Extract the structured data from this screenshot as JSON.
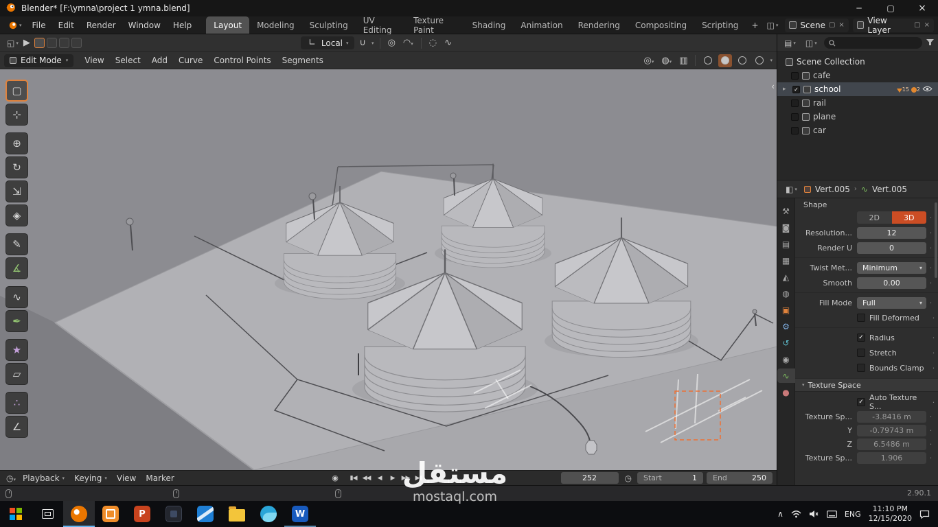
{
  "window": {
    "title": "Blender* [F:\\ymna\\project 1 ymna.blend]",
    "minimize": "─",
    "maximize": "▢",
    "close": "×"
  },
  "colors": {
    "accent_orange": "#e0823c",
    "active_3d_button": "#cb4d24",
    "selected_row": "#41464d"
  },
  "topbar": {
    "menus": [
      "File",
      "Edit",
      "Render",
      "Window",
      "Help"
    ],
    "workspaces": [
      "Layout",
      "Modeling",
      "Sculpting",
      "UV Editing",
      "Texture Paint",
      "Shading",
      "Animation",
      "Rendering",
      "Compositing",
      "Scripting"
    ],
    "add_workspace": "+",
    "scene": "Scene",
    "view_layer": "View Layer"
  },
  "tool_settings": {
    "orientation": "Local"
  },
  "viewport": {
    "mode": "Edit Mode",
    "menus": [
      "View",
      "Select",
      "Add",
      "Curve",
      "Control Points",
      "Segments"
    ],
    "collapse_arrow": "‹"
  },
  "toolbar": {
    "tools": [
      {
        "name": "select-box",
        "glyph": "▢"
      },
      {
        "name": "cursor",
        "glyph": "⊹"
      },
      {
        "name": "move",
        "glyph": "⊕"
      },
      {
        "name": "rotate",
        "glyph": "↻"
      },
      {
        "name": "scale",
        "glyph": "⇲"
      },
      {
        "name": "transform",
        "glyph": "◈"
      },
      {
        "name": "annotate",
        "glyph": "✎"
      },
      {
        "name": "measure",
        "glyph": "∡"
      },
      {
        "name": "draw",
        "glyph": "∿"
      },
      {
        "name": "curve-pen",
        "glyph": "✒"
      },
      {
        "name": "extrude",
        "glyph": "★"
      },
      {
        "name": "shear",
        "glyph": "▱"
      },
      {
        "name": "randomize",
        "glyph": "∴"
      },
      {
        "name": "tilt",
        "glyph": "∠"
      }
    ]
  },
  "outliner": {
    "root": "Scene Collection",
    "items": [
      {
        "label": "cafe"
      },
      {
        "label": "school",
        "badge1": "15",
        "badge2": "2"
      },
      {
        "label": "rail"
      },
      {
        "label": "plane"
      },
      {
        "label": "car"
      }
    ]
  },
  "properties": {
    "breadcrumb_object": "Vert.005",
    "breadcrumb_data": "Vert.005",
    "shape_header": "Shape",
    "d2": "2D",
    "d3": "3D",
    "resolution_label": "Resolution...",
    "resolution": "12",
    "render_u_label": "Render U",
    "render_u": "0",
    "twist_label": "Twist Met...",
    "twist": "Minimum",
    "smooth_label": "Smooth",
    "smooth": "0.00",
    "fill_mode_label": "Fill Mode",
    "fill_mode": "Full",
    "fill_deformed": "Fill Deformed",
    "radius": "Radius",
    "stretch": "Stretch",
    "bounds_clamp": "Bounds Clamp",
    "texture_header": "Texture Space",
    "auto_texture": "Auto Texture S...",
    "tex_x_label": "Texture Sp...",
    "tex_x": "-3.8416 m",
    "tex_y_label": "Y",
    "tex_y": "-0.79743 m",
    "tex_z_label": "Z",
    "tex_z": "6.5486 m",
    "tex_size_label": "Texture Sp...",
    "tex_size": "1.906",
    "tabs": [
      {
        "name": "tool",
        "glyph": "⚒"
      },
      {
        "name": "render",
        "glyph": "◙"
      },
      {
        "name": "output",
        "glyph": "▤"
      },
      {
        "name": "view-layer",
        "glyph": "▦"
      },
      {
        "name": "scene",
        "glyph": "◭"
      },
      {
        "name": "world",
        "glyph": "◍"
      },
      {
        "name": "object",
        "glyph": "▣"
      },
      {
        "name": "modifiers",
        "glyph": "⚙"
      },
      {
        "name": "physics",
        "glyph": "↺"
      },
      {
        "name": "constraints",
        "glyph": "◉"
      },
      {
        "name": "object-data",
        "glyph": "∿"
      },
      {
        "name": "material",
        "glyph": "●"
      }
    ]
  },
  "timeline": {
    "playback": "Playback",
    "keying": "Keying",
    "menus": [
      "View",
      "Marker"
    ],
    "buttons": [
      {
        "name": "auto-keyframe",
        "glyph": "◉"
      },
      {
        "name": "jump-to-start",
        "glyph": "▮◀"
      },
      {
        "name": "prev-keyframe",
        "glyph": "◀◀"
      },
      {
        "name": "play-reverse",
        "glyph": "◀"
      },
      {
        "name": "play",
        "glyph": "▶"
      },
      {
        "name": "next-keyframe",
        "glyph": "▶▶"
      },
      {
        "name": "jump-to-end",
        "glyph": "▶▮"
      }
    ],
    "frame": "252",
    "start_label": "Start",
    "start": "1",
    "end_label": "End",
    "end": "250"
  },
  "statusbar": {
    "version": "2.90.1"
  },
  "taskbar": {
    "apps": [
      {
        "name": "blender"
      },
      {
        "name": "orange-app"
      },
      {
        "name": "powerpoint",
        "letter": "P"
      },
      {
        "name": "dark-app"
      },
      {
        "name": "code-app"
      },
      {
        "name": "file-explorer"
      },
      {
        "name": "browser"
      },
      {
        "name": "word",
        "letter": "W"
      }
    ],
    "tray": {
      "lang": "ENG",
      "time": "11:10 PM",
      "date": "12/15/2020"
    }
  },
  "watermark": {
    "title": "مستقل",
    "site": "mostaql.com"
  }
}
